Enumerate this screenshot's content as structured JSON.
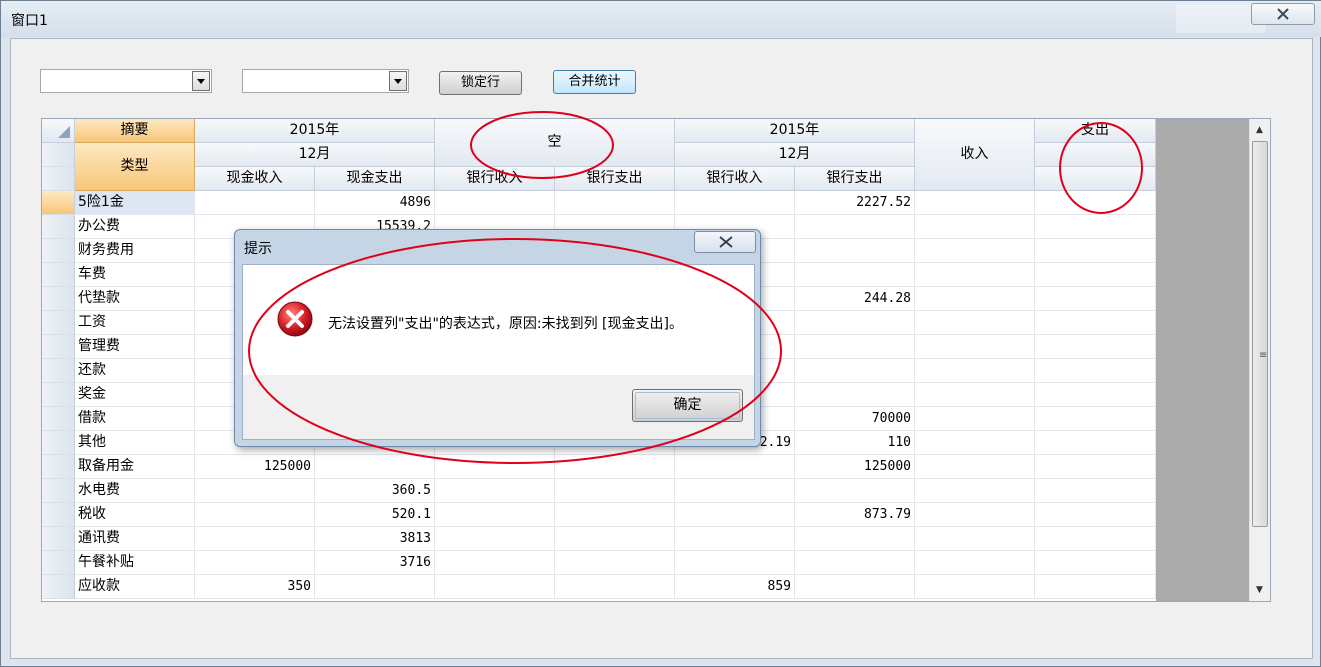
{
  "window": {
    "title": "窗口1"
  },
  "toolbar": {
    "combo1_value": "",
    "combo2_value": "",
    "lock_row_label": "锁定行",
    "merge_stats_label": "合并统计"
  },
  "grid": {
    "header": {
      "summary": "摘要",
      "type": "类型",
      "year1": "2015年",
      "month1": "12月",
      "empty": "空",
      "year2": "2015年",
      "month2": "12月",
      "income": "收入",
      "expense": "支出",
      "columns": [
        "现金收入",
        "现金支出",
        "银行收入",
        "银行支出",
        "银行收入",
        "银行支出"
      ]
    },
    "rows": [
      [
        "5险1金",
        "",
        "4896",
        "",
        "",
        "",
        "2227.52",
        "",
        ""
      ],
      [
        "办公费",
        "",
        "15539.2",
        "",
        "",
        "",
        "",
        "",
        ""
      ],
      [
        "财务费用",
        "",
        "",
        "",
        "",
        "",
        "",
        "",
        ""
      ],
      [
        "车费",
        "",
        "",
        "",
        "",
        "",
        "",
        "",
        ""
      ],
      [
        "代垫款",
        "",
        "",
        "",
        "",
        "",
        "244.28",
        "",
        ""
      ],
      [
        "工资",
        "",
        "",
        "",
        "",
        "",
        "",
        "",
        ""
      ],
      [
        "管理费",
        "",
        "",
        "",
        "",
        "",
        "",
        "",
        ""
      ],
      [
        "还款",
        "",
        "",
        "",
        "",
        "",
        "",
        "",
        ""
      ],
      [
        "奖金",
        "",
        "",
        "",
        "",
        "",
        "",
        "",
        ""
      ],
      [
        "借款",
        "",
        "",
        "",
        "",
        "",
        "70000",
        "",
        ""
      ],
      [
        "其他",
        "",
        "",
        "",
        "",
        "2.19",
        "110",
        "",
        ""
      ],
      [
        "取备用金",
        "125000",
        "",
        "",
        "",
        "",
        "125000",
        "",
        ""
      ],
      [
        "水电费",
        "",
        "360.5",
        "",
        "",
        "",
        "",
        "",
        ""
      ],
      [
        "税收",
        "",
        "520.1",
        "",
        "",
        "",
        "873.79",
        "",
        ""
      ],
      [
        "通讯费",
        "",
        "3813",
        "",
        "",
        "",
        "",
        "",
        ""
      ],
      [
        "午餐补贴",
        "",
        "3716",
        "",
        "",
        "",
        "",
        "",
        ""
      ],
      [
        "应收款",
        "350",
        "",
        "",
        "",
        "859",
        "",
        "",
        ""
      ]
    ]
  },
  "dialog": {
    "title": "提示",
    "message": "无法设置列\"支出\"的表达式，原因:未找到列 [现金支出]。",
    "ok_label": "确定"
  },
  "colors": {
    "header_orange": "#f8c679",
    "annotation_red": "#e0001a",
    "error_red": "#c8102e"
  }
}
